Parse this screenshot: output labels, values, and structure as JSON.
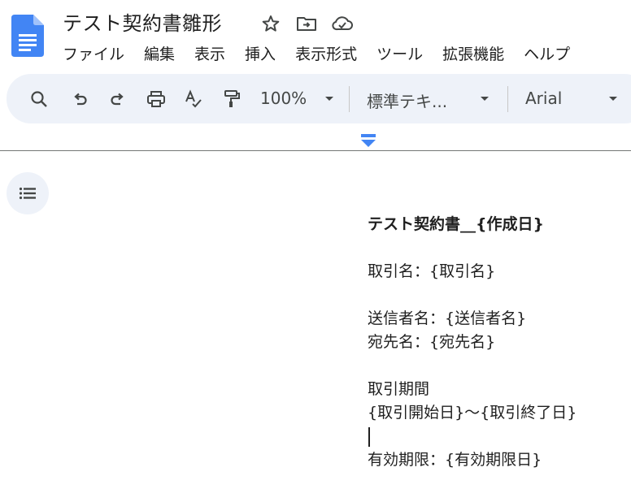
{
  "app": {
    "document_title": "テスト契約書雛形",
    "brand_color": "#4285f4"
  },
  "title_icons": [
    "star-icon",
    "move-to-folder-icon",
    "cloud-saved-icon"
  ],
  "menu": {
    "items": [
      "ファイル",
      "編集",
      "表示",
      "挿入",
      "表示形式",
      "ツール",
      "拡張機能",
      "ヘルプ"
    ]
  },
  "toolbar": {
    "icons": [
      "search-icon",
      "undo-icon",
      "redo-icon",
      "print-icon",
      "spellcheck-icon",
      "paint-format-icon"
    ],
    "zoom": "100%",
    "style": "標準テキ...",
    "font": "Arial"
  },
  "document": {
    "heading": "テスト契約書__{作成日}",
    "lines": [
      "",
      "取引名：{取引名}",
      "",
      "送信者名：{送信者名}",
      "宛先名：{宛先名}",
      "",
      "取引期間",
      "{取引開始日}〜{取引終了日}",
      "",
      "有効期限：{有効期限日}"
    ]
  }
}
